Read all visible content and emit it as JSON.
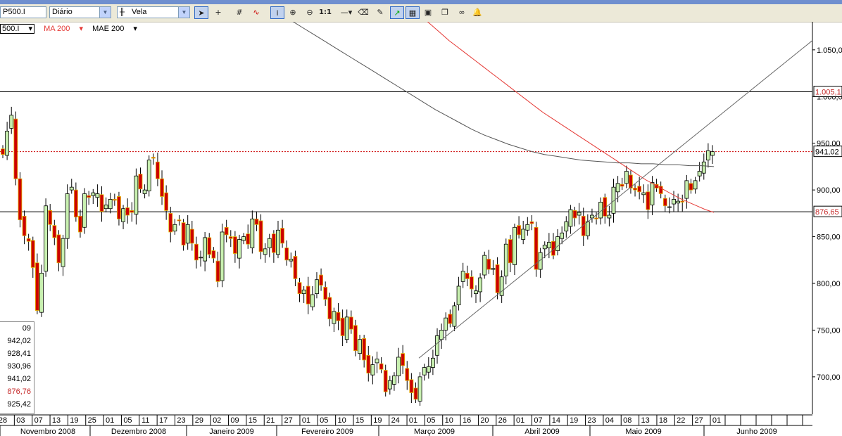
{
  "toolbar": {
    "symbol": "P500.I",
    "period": "Diário",
    "style": "Vela",
    "icons": [
      "cursor-icon",
      "crosshair-icon",
      "grid-icon",
      "indicator-icon",
      "info-icon",
      "zoom-in-icon",
      "zoom-out-icon",
      "zoom-reset-icon",
      "line-icon",
      "eraser-icon",
      "draw-icon",
      "trend-up-icon",
      "trend-grid-icon",
      "save-icon",
      "copy-icon",
      "link-icon",
      "alert-icon"
    ],
    "zoom_label": "1:1"
  },
  "legend": {
    "symbol": "500.I",
    "ma": "MA 200",
    "mae": "MAE 200",
    "ma_color": "#e53935"
  },
  "infobox": [
    "09",
    "942,02",
    "928,41",
    "930,96",
    "941,02",
    "876,76",
    "925,42"
  ],
  "infobox_colors": [
    "#000",
    "#000",
    "#000",
    "#000",
    "#000",
    "#c62828",
    "#000"
  ],
  "chart_data": {
    "type": "candlestick",
    "ylim": [
      660,
      1080
    ],
    "y_ticks": [
      700,
      750,
      800,
      850,
      900,
      950,
      1000,
      1050
    ],
    "y_tick_labels": [
      "700,00",
      "750,00",
      "800,00",
      "850,00",
      "900,00",
      "950,00",
      "1.000,00",
      "1.050,00"
    ],
    "x_day_labels": [
      "28",
      "03",
      "07",
      "13",
      "19",
      "25",
      "01",
      "05",
      "11",
      "17",
      "23",
      "29",
      "02",
      "09",
      "15",
      "21",
      "27",
      "01",
      "05",
      "10",
      "15",
      "19",
      "24",
      "01",
      "05",
      "10",
      "16",
      "20",
      "26",
      "01",
      "07",
      "14",
      "19",
      "23",
      "04",
      "08",
      "13",
      "18",
      "22",
      "27",
      "01"
    ],
    "month_labels": [
      "Novembro 2008",
      "Dezembro 2008",
      "Janeiro 2009",
      "Fevereiro 2009",
      "Março 2009",
      "Abril 2009",
      "Maio 2009",
      "Junho 2009"
    ],
    "horizontal_lines": [
      {
        "value": 1005.1,
        "label": "1.005,1",
        "color": "#000000",
        "style": "solid"
      },
      {
        "value": 941.02,
        "label": "941,02",
        "color": "#cc0000",
        "style": "dotted"
      },
      {
        "value": 876.65,
        "label": "876,65",
        "color": "#000000",
        "style": "solid"
      }
    ],
    "series": [
      {
        "name": "close",
        "values": [
          938,
          963,
          980,
          912,
          868,
          851,
          845,
          817,
          771,
          811,
          883,
          863,
          849,
          822,
          848,
          896,
          903,
          871,
          855,
          896,
          892,
          897,
          896,
          877,
          884,
          890,
          889,
          869,
          880,
          873,
          876,
          915,
          901,
          900,
          932,
          934,
          912,
          893,
          878,
          855,
          863,
          867,
          841,
          863,
          843,
          825,
          828,
          849,
          831,
          827,
          802,
          855,
          852,
          848,
          832,
          847,
          850,
          842,
          869,
          863,
          834,
          837,
          848,
          833,
          857,
          843,
          825,
          826,
          805,
          789,
          793,
          778,
          788,
          804,
          798,
          783,
          762,
          770,
          760,
          744,
          764,
          751,
          728,
          740,
          718,
          704,
          713,
          719,
          708,
          684,
          696,
          701,
          721,
          712,
          696,
          683,
          676,
          700,
          710,
          711,
          720,
          744,
          750,
          763,
          757,
          776,
          797,
          813,
          805,
          794,
          792,
          806,
          830,
          815,
          816,
          790,
          807,
          842,
          822,
          860,
          852,
          858,
          863,
          864,
          815,
          833,
          841,
          844,
          830,
          850,
          854,
          866,
          879,
          870,
          876,
          851,
          866,
          873,
          869,
          887,
          872,
          873,
          903,
          907,
          904,
          920,
          902,
          900,
          898,
          897,
          879,
          908,
          902,
          896,
          883,
          882,
          890,
          888,
          887,
          910,
          900,
          910,
          920,
          930,
          942,
          941
        ],
        "color": "#000000"
      },
      {
        "name": "MA 200",
        "color": "#e53935",
        "values": [
          1220,
          1212,
          1204,
          1196,
          1188,
          1180,
          1172,
          1164,
          1156,
          1148,
          1140,
          1132,
          1124,
          1116,
          1108,
          1100,
          1092,
          1084,
          1076,
          1068,
          1060,
          1053,
          1046,
          1039,
          1032,
          1025,
          1018,
          1011,
          1004,
          997,
          990,
          983,
          977,
          971,
          965,
          959,
          953,
          947,
          941,
          935,
          929,
          923,
          917,
          911,
          906,
          901,
          896,
          891,
          887,
          883,
          879,
          876
        ]
      },
      {
        "name": "MAE 200",
        "color": "#555555",
        "values": [
          1090,
          1082,
          1074,
          1066,
          1058,
          1050,
          1042,
          1034,
          1026,
          1018,
          1010,
          1002,
          994,
          986,
          979,
          972,
          965,
          959,
          954,
          949,
          945,
          941,
          938,
          936,
          934,
          932,
          931,
          930,
          929,
          929,
          928,
          928,
          927,
          927,
          926,
          926,
          925
        ]
      }
    ],
    "trendline": [
      [
        708,
        720
      ],
      [
        1060,
        1060
      ]
    ]
  }
}
